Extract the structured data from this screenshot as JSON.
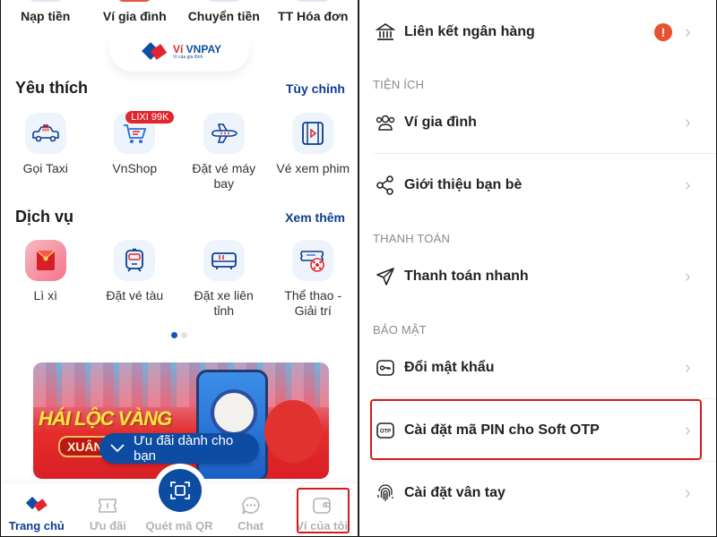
{
  "home": {
    "quick_actions": [
      {
        "label": "Nạp tiền",
        "icon": "top-up-icon"
      },
      {
        "label": "Ví gia đình",
        "icon": "family-wallet-icon"
      },
      {
        "label": "Chuyển tiền",
        "icon": "transfer-icon"
      },
      {
        "label": "TT Hóa đơn",
        "icon": "bill-payment-icon"
      }
    ],
    "logo": {
      "brand_prefix": "Ví ",
      "brand_name": "VNPAY",
      "tagline": "Ví của gia đình"
    },
    "favorites": {
      "title": "Yêu thích",
      "action": "Tùy chỉnh",
      "items": [
        {
          "label": "Gọi Taxi",
          "icon": "taxi-icon"
        },
        {
          "label": "VnShop",
          "icon": "shopping-cart-icon",
          "badge": "LIXI 99K"
        },
        {
          "label": "Đặt vé máy bay",
          "icon": "airplane-icon"
        },
        {
          "label": "Vé xem phim",
          "icon": "film-icon"
        }
      ]
    },
    "services": {
      "title": "Dịch vụ",
      "action": "Xem thêm",
      "items": [
        {
          "label": "Lì xì",
          "icon": "red-envelope-icon"
        },
        {
          "label": "Đặt vé tàu",
          "icon": "train-icon"
        },
        {
          "label": "Đặt xe liên tỉnh",
          "icon": "bus-icon"
        },
        {
          "label": "Thể thao - Giải trí",
          "icon": "sports-ticket-icon"
        }
      ],
      "page_indicator": {
        "current": 1,
        "total": 2
      }
    },
    "banner": {
      "headline": "HÁI LỘC VÀNG",
      "subheadline": "XUÂN ĐẠT ĐẤT",
      "promo_button": "Ưu đãi dành cho bạn"
    },
    "bottom_nav": [
      {
        "label": "Trang chủ",
        "icon": "home-logo-icon",
        "active": true
      },
      {
        "label": "Ưu đãi",
        "icon": "voucher-icon",
        "active": false
      },
      {
        "label": "Quét mã QR",
        "icon": "qr-scan-icon",
        "active": false
      },
      {
        "label": "Chat",
        "icon": "chat-icon",
        "active": false
      },
      {
        "label": "Ví của tôi",
        "icon": "wallet-icon",
        "active": false,
        "highlighted": true
      }
    ]
  },
  "wallet_menu": {
    "items_top": [
      {
        "label": "Liên kết ngân hàng",
        "icon": "bank-icon",
        "alert": "!"
      }
    ],
    "sections": [
      {
        "title": "TIỆN ÍCH",
        "items": [
          {
            "label": "Ví gia đình",
            "icon": "family-icon"
          },
          {
            "label": "Giới thiệu bạn bè",
            "icon": "share-icon"
          }
        ]
      },
      {
        "title": "THANH TOÁN",
        "items": [
          {
            "label": "Thanh toán nhanh",
            "icon": "send-icon"
          }
        ]
      },
      {
        "title": "BẢO MẬT",
        "items": [
          {
            "label": "Đổi mật khẩu",
            "icon": "key-icon"
          },
          {
            "label": "Cài đặt mã PIN cho Soft OTP",
            "icon": "otp-icon",
            "highlighted": true
          },
          {
            "label": "Cài đặt vân tay",
            "icon": "fingerprint-icon"
          }
        ]
      }
    ],
    "otp_icon_text": "OTP"
  },
  "colors": {
    "brand_blue": "#0b3d91",
    "brand_red": "#e1262d",
    "highlight": "#d01c1c",
    "alert": "#e8502f"
  }
}
